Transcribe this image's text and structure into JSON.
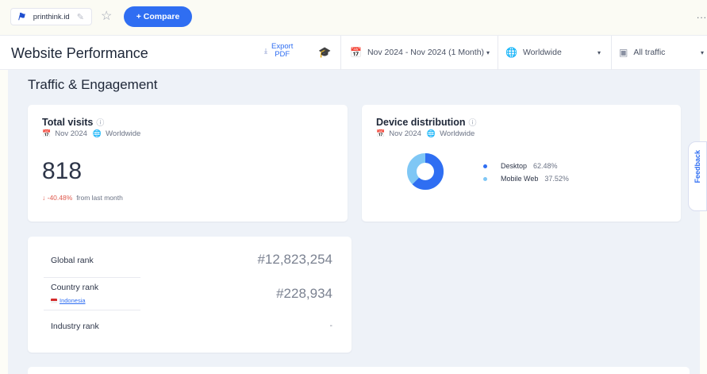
{
  "topbar": {
    "site_name": "printhink.id",
    "compare_label": "+ Compare",
    "more_label": "..."
  },
  "header": {
    "title": "Website Performance",
    "export_label_1": "Export",
    "export_label_2": "PDF",
    "date_range": "Nov 2024 - Nov 2024 (1 Month)",
    "region": "Worldwide",
    "traffic": "All traffic"
  },
  "section": {
    "title": "Traffic & Engagement"
  },
  "total_visits": {
    "title": "Total visits",
    "period": "Nov 2024",
    "region": "Worldwide",
    "value": "818",
    "change": "↓ -40.48%",
    "change_note": "from last month"
  },
  "device_distribution": {
    "title": "Device distribution",
    "period": "Nov 2024",
    "region": "Worldwide",
    "items": [
      {
        "label": "Desktop",
        "value": "62.48%",
        "share": 62.48,
        "color": "#2f6ef2"
      },
      {
        "label": "Mobile Web",
        "value": "37.52%",
        "share": 37.52,
        "color": "#7fc7f5"
      }
    ]
  },
  "ranks": {
    "global_label": "Global rank",
    "global_value": "#12,823,254",
    "country_label": "Country rank",
    "country_name": "Indonesia",
    "country_value": "#228,934",
    "industry_label": "Industry rank",
    "industry_value": "-"
  },
  "feedback_label": "Feedback",
  "colors": {
    "accent": "#2f6ef2",
    "negative": "#e05a4e",
    "background": "#eef2f8"
  }
}
